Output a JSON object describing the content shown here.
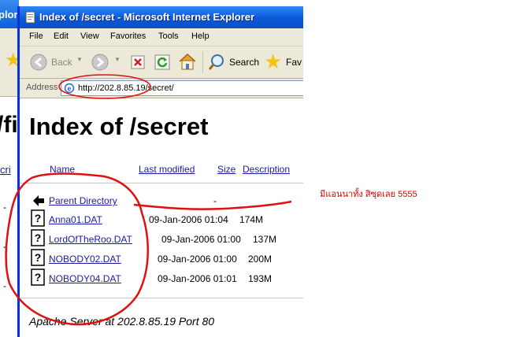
{
  "background_window": {
    "title_fragment": "plor",
    "heading_fragment": "/fi",
    "column_fragment": "cri",
    "rows": [
      "-",
      "-",
      "-"
    ]
  },
  "window": {
    "title": "Index of /secret - Microsoft Internet Explorer"
  },
  "menu": {
    "items": [
      "File",
      "Edit",
      "View",
      "Favorites",
      "Tools",
      "Help"
    ]
  },
  "toolbar": {
    "back_label": "Back",
    "search_label": "Search",
    "favorites_label": "Fav"
  },
  "address_bar": {
    "label": "Address",
    "url": "http://202.8.85.19/secret/"
  },
  "page": {
    "title": "Index of /secret",
    "columns": [
      "Name",
      "Last modified",
      "Size",
      "Description"
    ],
    "parent": {
      "name": "Parent Directory",
      "size": "-"
    },
    "files": [
      {
        "name": "Anna01.DAT",
        "modified": "09-Jan-2006 01:04",
        "size": "174M"
      },
      {
        "name": "LordOfTheRoo.DAT",
        "modified": "09-Jan-2006 01:00",
        "size": "137M"
      },
      {
        "name": "NOBODY02.DAT",
        "modified": "09-Jan-2006 01:00",
        "size": "200M"
      },
      {
        "name": "NOBODY04.DAT",
        "modified": "09-Jan-2006 01:01",
        "size": "193M"
      }
    ],
    "server_line": "Apache Server at 202.8.85.19 Port 80"
  },
  "annotation": {
    "text": "มีแอนนาทั้ง สิซุดเลย 5555",
    "color": "#e00000"
  }
}
